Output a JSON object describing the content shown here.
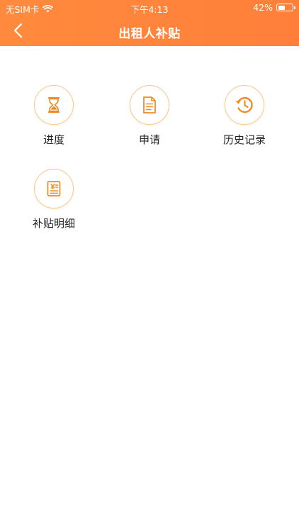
{
  "status_bar": {
    "carrier": "无SIM卡",
    "time": "下午4:13",
    "battery_percent": "42%",
    "battery_level": 0.42
  },
  "nav": {
    "title": "出租人补贴",
    "back_icon": "chevron-left-icon"
  },
  "tiles": [
    {
      "label": "进度",
      "icon": "hourglass-icon"
    },
    {
      "label": "申请",
      "icon": "document-icon"
    },
    {
      "label": "历史记录",
      "icon": "history-clock-icon"
    },
    {
      "label": "补贴明细",
      "icon": "yuan-receipt-icon"
    }
  ],
  "colors": {
    "header": "#ff8a3d",
    "icon": "#f08a24",
    "ring": "#f6c98f"
  }
}
